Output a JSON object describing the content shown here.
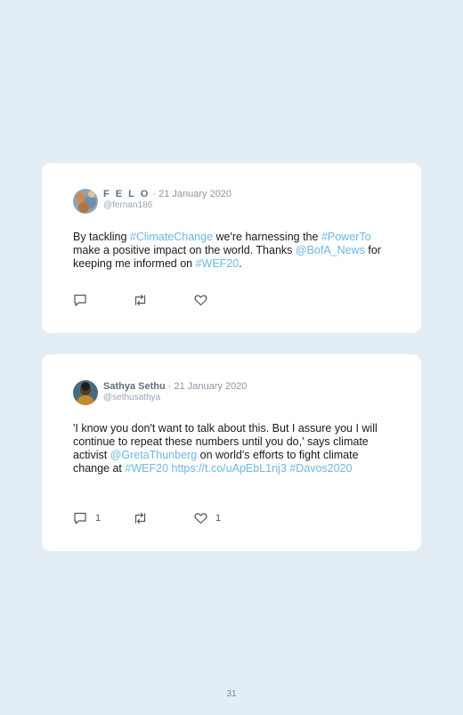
{
  "tweets": [
    {
      "name": "F E L O",
      "date": "· 21 January 2020",
      "handle": "@fernan186",
      "text": [
        {
          "t": "By tackling ",
          "link": false
        },
        {
          "t": "#ClimateChange",
          "link": true
        },
        {
          "t": " we're harnessing the ",
          "link": false
        },
        {
          "t": "#PowerTo",
          "link": true
        },
        {
          "t": " make a positive impact on the world. Thanks ",
          "link": false
        },
        {
          "t": "@BofA_News",
          "link": true
        },
        {
          "t": " for keeping me informed on ",
          "link": false
        },
        {
          "t": "#WEF20",
          "link": true
        },
        {
          "t": ".",
          "link": false
        }
      ],
      "replies": "",
      "likes": ""
    },
    {
      "name": "Sathya Sethu",
      "date": "· 21 January 2020",
      "handle": "@sethusathya",
      "text": [
        {
          "t": "'I know you don't want to talk about this. But I assure you I will continue to repeat these numbers until you do,' says climate activist ",
          "link": false
        },
        {
          "t": "@GretaThunberg",
          "link": true
        },
        {
          "t": " on world's efforts to fight climate change at ",
          "link": false
        },
        {
          "t": "#WEF20",
          "link": true
        },
        {
          "t": " ",
          "link": false
        },
        {
          "t": "https://t.co/uApEbL1nj3",
          "link": true
        },
        {
          "t": " ",
          "link": false
        },
        {
          "t": "#Davos2020",
          "link": true
        }
      ],
      "replies": "1",
      "likes": "1"
    }
  ],
  "page_number": "31",
  "colors": {
    "background": "#e3edf6",
    "link": "#6cb8e3",
    "card": "#ffffff"
  },
  "icons": [
    "reply-icon",
    "retweet-icon",
    "like-icon"
  ]
}
